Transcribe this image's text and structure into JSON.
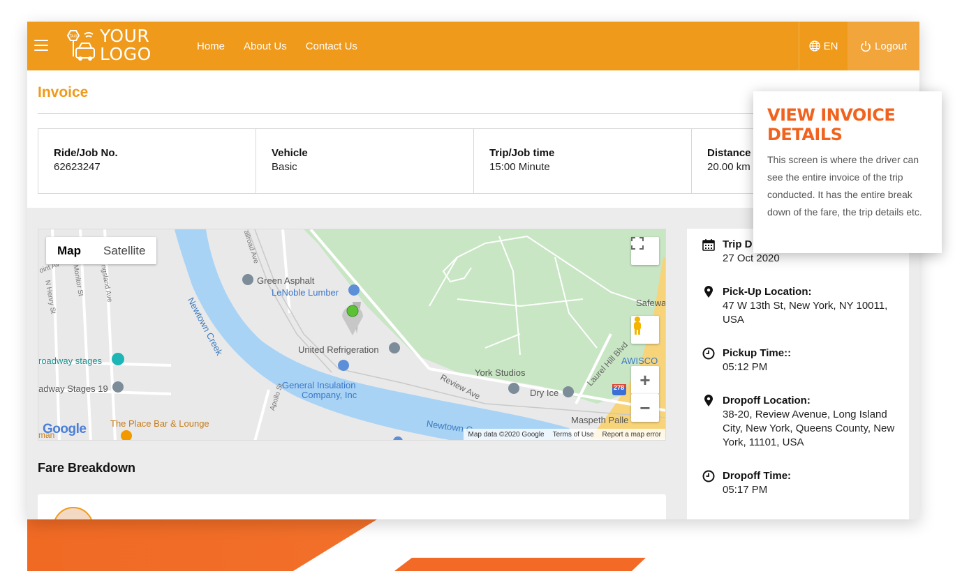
{
  "header": {
    "logo_line1": "YOUR",
    "logo_line2": "LOGO",
    "nav": [
      "Home",
      "About Us",
      "Contact Us"
    ],
    "language": "EN",
    "logout": "Logout"
  },
  "invoice": {
    "title": "Invoice",
    "fields": [
      {
        "label": "Ride/Job No.",
        "value": "62623247"
      },
      {
        "label": "Vehicle",
        "value": "Basic"
      },
      {
        "label": "Trip/Job time",
        "value": "15:00 Minute"
      },
      {
        "label": "Distance",
        "value": "20.00 km"
      }
    ]
  },
  "map": {
    "tabs": [
      "Map",
      "Satellite"
    ],
    "labels": {
      "green_asphalt": "Green Asphalt",
      "lenoble": "LeNoble Lumber",
      "newtown_creek": "Newtown Creek",
      "united_refrigeration": "United Refrigeration",
      "broadway_stages": "roadway stages",
      "adway_stages_19": "adway Stages 19",
      "general_insulation_1": "General Insulation",
      "general_insulation_2": "Company, Inc",
      "place_bar": "The Place Bar & Lounge",
      "york_studios": "York Studios",
      "dry_ice": "Dry Ice",
      "review_ave": "Review Ave",
      "laurel_hill": "Laurel Hill Blvd",
      "awisco": "AWISCO",
      "safeway": "Safewa",
      "maspeth": "Maspeth Palle",
      "newtown_c2": "Newtown C",
      "monitor_st": "Monitor St",
      "n_henry_st": "N Henry St",
      "apollo_st": "Apollo St",
      "railroad_ave": "ailroad Ave",
      "island_ave": "ngsland Ave",
      "oint_av": "oint Av",
      "man": "man",
      "route_278": "278"
    },
    "google": "Google",
    "footer": [
      "Map data ©2020 Google",
      "Terms of Use",
      "Report a map error"
    ]
  },
  "fare": {
    "title": "Fare Breakdown"
  },
  "trip": {
    "items": [
      {
        "label": "Trip D",
        "value": "27 Oct 2020",
        "icon": "calendar-icon"
      },
      {
        "label": "Pick-Up Location:",
        "value": "47 W 13th St, New York, NY 10011, USA",
        "icon": "location-pin-icon"
      },
      {
        "label": "Pickup Time::",
        "value": "05:12 PM",
        "icon": "clock-icon"
      },
      {
        "label": "Dropoff Location:",
        "value": "38-20, Review Avenue, Long Island City, New York, Queens County, New York, 11101, USA",
        "icon": "location-pin-icon"
      },
      {
        "label": "Dropoff Time:",
        "value": "05:17 PM",
        "icon": "clock-icon"
      }
    ]
  },
  "callout": {
    "title": "VIEW INVOICE DETAILS",
    "body": "This screen is where the driver can see the entire invoice of the trip conducted. It has the entire break down of the fare, the trip details etc."
  },
  "colors": {
    "brand_orange": "#ef9a1a",
    "accent_red_orange": "#f0621e"
  }
}
